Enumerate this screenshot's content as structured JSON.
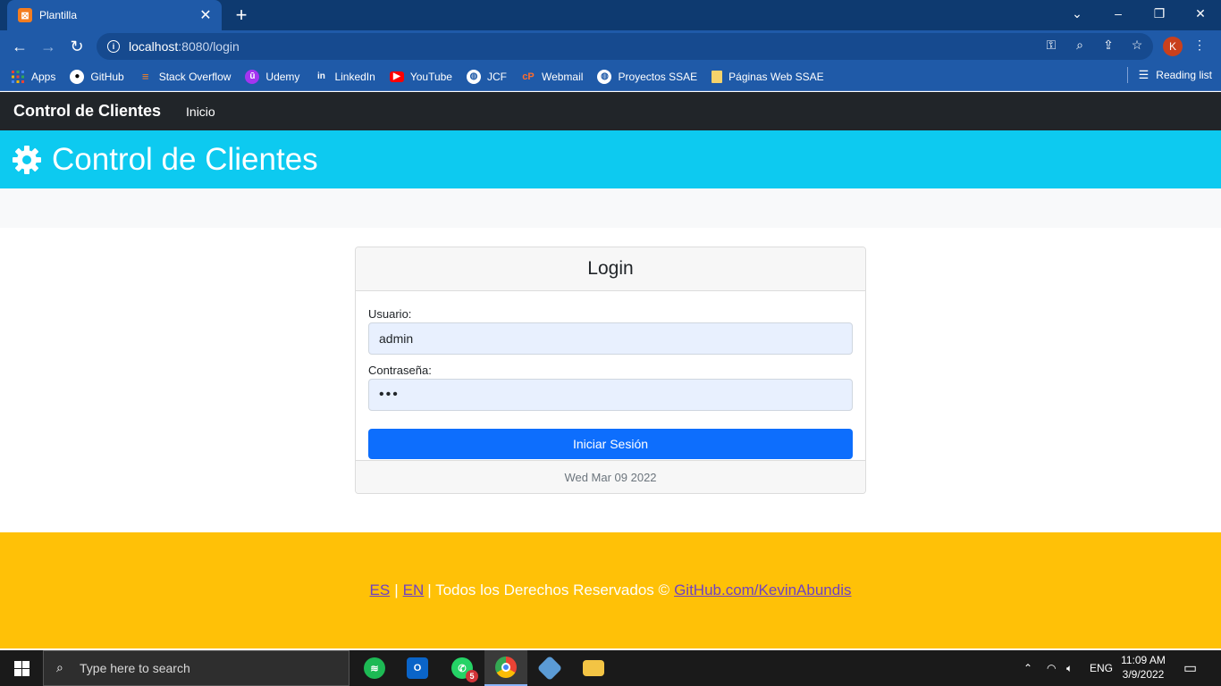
{
  "browser": {
    "tab_title": "Plantilla",
    "tab_close": "✕",
    "new_tab": "+",
    "url_host": "localhost",
    "url_path": ":8080/login",
    "profile_initial": "K",
    "bookmarks": [
      {
        "label": "Apps",
        "icon": "apps-grid-icon"
      },
      {
        "label": "GitHub",
        "icon": "github-icon"
      },
      {
        "label": "Stack Overflow",
        "icon": "stackoverflow-icon"
      },
      {
        "label": "Udemy",
        "icon": "udemy-icon"
      },
      {
        "label": "LinkedIn",
        "icon": "linkedin-icon"
      },
      {
        "label": "YouTube",
        "icon": "youtube-icon"
      },
      {
        "label": "JCF",
        "icon": "globe-icon"
      },
      {
        "label": "Webmail",
        "icon": "cpanel-icon"
      },
      {
        "label": "Proyectos SSAE",
        "icon": "globe-icon"
      },
      {
        "label": "Páginas Web SSAE",
        "icon": "folder-icon"
      }
    ],
    "reading_list": "Reading list"
  },
  "app": {
    "brand": "Control de Clientes",
    "nav_inicio": "Inicio",
    "hero_title": "Control de Clientes"
  },
  "login": {
    "title": "Login",
    "username_label": "Usuario:",
    "username_value": "admin",
    "password_label": "Contraseña:",
    "password_value": "•••",
    "submit_label": "Iniciar Sesión",
    "date": "Wed Mar 09 2022"
  },
  "footer": {
    "lang_es": "ES",
    "lang_en": "EN",
    "separator": "|",
    "rights_text": "| Todos los Derechos Reservados ©",
    "github_link": "GitHub.com/KevinAbundis"
  },
  "taskbar": {
    "search_placeholder": "Type here to search",
    "whatsapp_badge": "5",
    "language": "ENG",
    "time": "11:09 AM",
    "date": "3/9/2022"
  },
  "colors": {
    "navbar": "#212529",
    "hero": "#0dcaf0",
    "primary_button": "#0d6efd",
    "footer": "#ffc107",
    "link": "#6f42c1"
  }
}
